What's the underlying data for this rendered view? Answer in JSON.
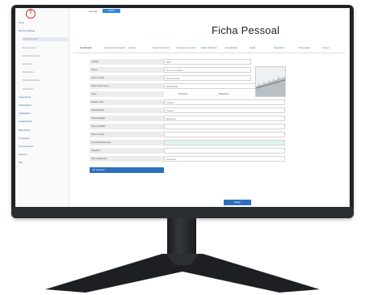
{
  "sidebar": {
    "logo": "T",
    "items": [
      {
        "label": "Início",
        "kind": "top"
      },
      {
        "label": "Minha Unidade",
        "kind": "top"
      },
      {
        "label": "Ficha Pessoal",
        "kind": "sub-active"
      },
      {
        "label": "Documentos",
        "kind": "sub"
      },
      {
        "label": "Ficha Funcional",
        "kind": "sub"
      },
      {
        "label": "Histórico",
        "kind": "sub"
      },
      {
        "label": "Relatórios",
        "kind": "sub"
      },
      {
        "label": "Movimentações",
        "kind": "sub"
      },
      {
        "label": "Atestados",
        "kind": "sub"
      },
      {
        "label": "Frequência",
        "kind": "top"
      },
      {
        "label": "Solicitações",
        "kind": "top"
      },
      {
        "label": "Avaliações",
        "kind": "top"
      },
      {
        "label": "Capacitação",
        "kind": "top"
      },
      {
        "label": "Benefícios",
        "kind": "top"
      },
      {
        "label": "Consultas",
        "kind": "top"
      },
      {
        "label": "Comunicados",
        "kind": "top"
      },
      {
        "label": "Suporte",
        "kind": "top"
      },
      {
        "label": "Sair",
        "kind": "top"
      }
    ]
  },
  "topbar": {
    "user": "Servidor",
    "badge": "Perfil"
  },
  "page": {
    "title": "Ficha Pessoal"
  },
  "tabs": [
    "Identificação",
    "Documentos Pessoais",
    "Família",
    "Dados Funcionais",
    "Endereço e Contato",
    "Dados Bancários",
    "Escolaridade",
    "Saúde",
    "Experiência",
    "Observações",
    "Anexos"
  ],
  "form": {
    "rows": [
      {
        "label": "Código",
        "value": "0001"
      },
      {
        "label": "Nome",
        "value": "Nome Completo"
      },
      {
        "label": "Nome Social",
        "value": "Nome Social"
      },
      {
        "label": "Data Nascimento",
        "value": "00/00/0000"
      },
      {
        "label": "Sexo",
        "radio_a": "Feminino",
        "radio_b": "Masculino"
      },
      {
        "label": "Estado Civil",
        "value": "Solteiro"
      },
      {
        "label": "Naturalidade",
        "value": "Cidade"
      },
      {
        "label": "Nacionalidade",
        "value": "Brasileira"
      },
      {
        "label": "Nome da Mãe",
        "value": ""
      },
      {
        "label": "Nome do Pai",
        "value": ""
      },
      {
        "label": "E-mail Institucional",
        "value": ""
      },
      {
        "label": "Raça/Cor",
        "value": ""
      },
      {
        "label": "Tipo Sanguíneo",
        "value": "Selecione"
      }
    ],
    "history_button": "Ver Histórico",
    "save_button": "Salvar"
  },
  "colors": {
    "accent": "#2e6fbd",
    "logo": "#d33a2c",
    "highlight": "#dff6ef"
  }
}
